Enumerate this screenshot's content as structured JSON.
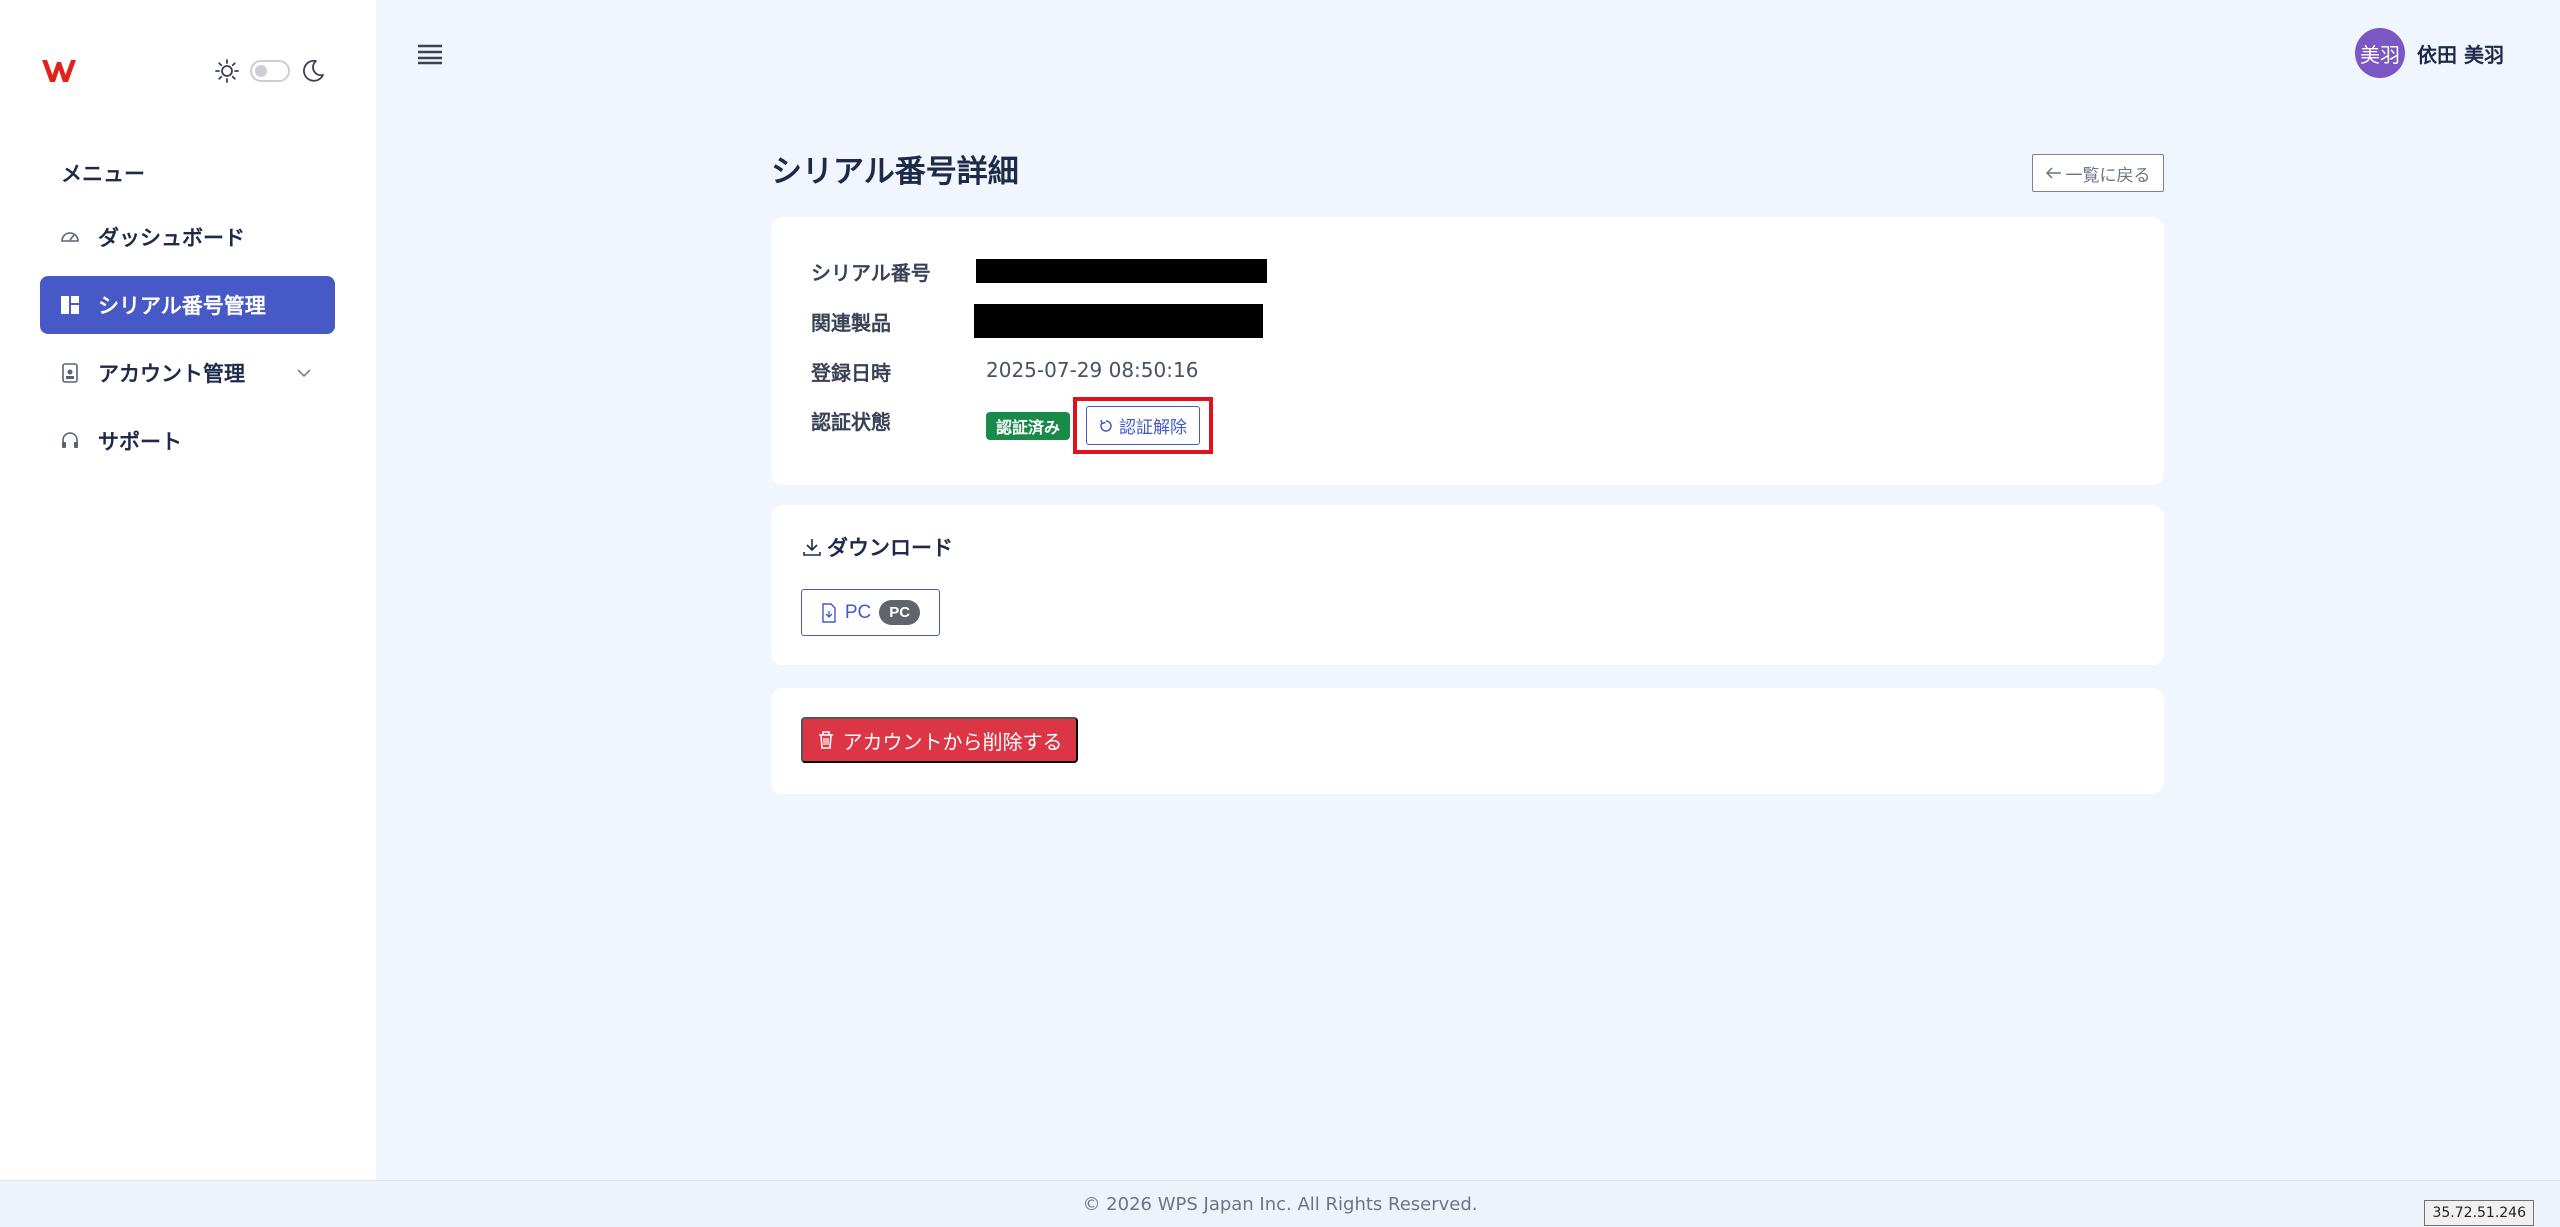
{
  "sidebar": {
    "menu_heading": "メニュー",
    "items": [
      {
        "label": "ダッシュボード",
        "icon": "gauge-icon",
        "active": false
      },
      {
        "label": "シリアル番号管理",
        "icon": "dashboard-grid-icon",
        "active": true
      },
      {
        "label": "アカウント管理",
        "icon": "badge-icon",
        "active": false,
        "expandable": true
      },
      {
        "label": "サポート",
        "icon": "headset-icon",
        "active": false
      }
    ]
  },
  "header": {
    "user_avatar_text": "美羽",
    "user_name": "依田 美羽"
  },
  "page": {
    "title": "シリアル番号詳細",
    "back_button": "一覧に戻る"
  },
  "details": {
    "serial_label": "シリアル番号",
    "product_label": "関連製品",
    "registered_label": "登録日時",
    "registered_value": "2025-07-29 08:50:16",
    "status_label": "認証状態",
    "status_badge": "認証済み",
    "unverify_button": "認証解除"
  },
  "download": {
    "title": "ダウンロード",
    "pc_button": "PC",
    "pc_pill": "PC"
  },
  "actions": {
    "delete_button": "アカウントから削除する"
  },
  "footer": {
    "copyright": "© 2026 WPS Japan Inc. All Rights Reserved.",
    "ip": "35.72.51.246"
  },
  "colors": {
    "accent": "#4659c6",
    "success": "#1a8a4a",
    "danger": "#dc3545",
    "highlight": "#e0101f"
  }
}
